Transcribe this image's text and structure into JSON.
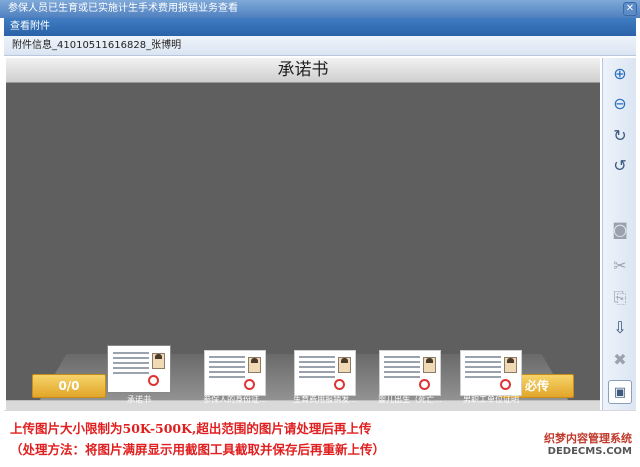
{
  "window": {
    "title": "参保人员已生育或已实施计生手术费用报销业务查看",
    "close_glyph": "✕"
  },
  "tab": {
    "label": "查看附件"
  },
  "attachment": {
    "info": "附件信息_41010511616828_张博明"
  },
  "viewer": {
    "doc_title": "承诺书",
    "counter": "0/0",
    "required_label": "必传",
    "thumbnails": [
      {
        "label": "承诺书",
        "selected": true
      },
      {
        "label": "参保人的身份证...",
        "selected": false
      },
      {
        "label": "生育费用报销发...",
        "selected": false
      },
      {
        "label": "婴儿出生（死亡...",
        "selected": false
      },
      {
        "label": "男职工单位证明",
        "selected": false
      }
    ]
  },
  "toolbar": {
    "items": [
      {
        "name": "zoom-in-icon",
        "glyph": "⊕"
      },
      {
        "name": "zoom-out-icon",
        "glyph": "⊖"
      },
      {
        "name": "rotate-right-icon",
        "glyph": "↻"
      },
      {
        "name": "rotate-left-icon",
        "glyph": "↺"
      },
      {
        "name": "camera-icon",
        "glyph": "◙"
      },
      {
        "name": "crop-scissors-icon",
        "glyph": "✂"
      },
      {
        "name": "attach-icon",
        "glyph": "⎘"
      },
      {
        "name": "download-icon",
        "glyph": "⇩"
      },
      {
        "name": "delete-icon",
        "glyph": "✖"
      },
      {
        "name": "save-icon",
        "glyph": "▣"
      }
    ]
  },
  "notice": {
    "line1": "上传图片大小限制为50K-500K,超出范围的图片请处理后再上传",
    "line2": "（处理方法：将图片满屏显示用截图工具截取并保存后再重新上传）"
  },
  "watermark": {
    "line1": "织梦内容管理系统",
    "line2": "DEDECMS.COM"
  }
}
